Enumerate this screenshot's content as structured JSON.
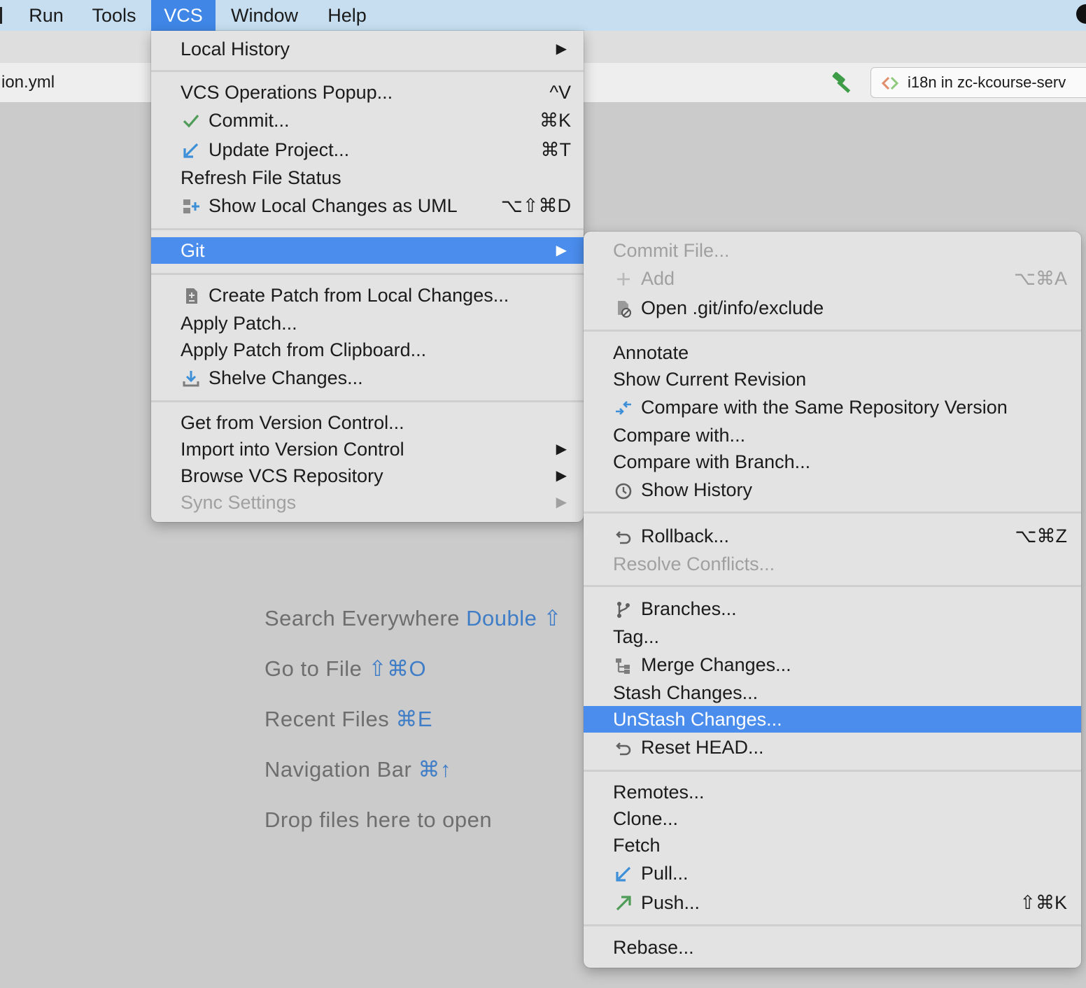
{
  "menubar": {
    "items": [
      "Run",
      "Tools",
      "VCS",
      "Window",
      "Help"
    ],
    "active": "VCS"
  },
  "editor": {
    "file_tab": "ion.yml",
    "run_config": "i18n in zc-kcourse-serv"
  },
  "hints": [
    {
      "text": "Search Everywhere",
      "key": "Double ⇧"
    },
    {
      "text": "Go to File",
      "key": "⇧⌘O"
    },
    {
      "text": "Recent Files",
      "key": "⌘E"
    },
    {
      "text": "Navigation Bar",
      "key": "⌘↑"
    },
    {
      "text": "Drop files here to open",
      "key": ""
    }
  ],
  "vcs_menu": {
    "local_history": {
      "label": "Local History"
    },
    "vcs_ops_popup": {
      "label": "VCS Operations Popup...",
      "shortcut": "^V"
    },
    "commit": {
      "label": "Commit...",
      "shortcut": "⌘K",
      "icon": "checkmark-icon"
    },
    "update_project": {
      "label": "Update Project...",
      "shortcut": "⌘T",
      "icon": "update-arrow-icon"
    },
    "refresh_status": {
      "label": "Refresh File Status"
    },
    "show_uml": {
      "label": "Show Local Changes as UML",
      "shortcut": "⌥⇧⌘D",
      "icon": "uml-icon"
    },
    "git": {
      "label": "Git"
    },
    "create_patch": {
      "label": "Create Patch from Local Changes...",
      "icon": "patch-icon"
    },
    "apply_patch": {
      "label": "Apply Patch..."
    },
    "apply_patch_clipboard": {
      "label": "Apply Patch from Clipboard..."
    },
    "shelve": {
      "label": "Shelve Changes...",
      "icon": "shelve-icon"
    },
    "get_from_vc": {
      "label": "Get from Version Control..."
    },
    "import_vc": {
      "label": "Import into Version Control"
    },
    "browse_repo": {
      "label": "Browse VCS Repository"
    },
    "sync_settings": {
      "label": "Sync Settings"
    }
  },
  "git_menu": {
    "commit_file": {
      "label": "Commit File..."
    },
    "add": {
      "label": "Add",
      "shortcut": "⌥⌘A",
      "icon": "plus-icon"
    },
    "open_exclude": {
      "label": "Open .git/info/exclude",
      "icon": "exclude-file-icon"
    },
    "annotate": {
      "label": "Annotate"
    },
    "show_current_revision": {
      "label": "Show Current Revision"
    },
    "compare_same_repo": {
      "label": "Compare with the Same Repository Version",
      "icon": "compare-icon"
    },
    "compare_with": {
      "label": "Compare with..."
    },
    "compare_branch": {
      "label": "Compare with Branch..."
    },
    "show_history": {
      "label": "Show History",
      "icon": "clock-icon"
    },
    "rollback": {
      "label": "Rollback...",
      "shortcut": "⌥⌘Z",
      "icon": "undo-icon"
    },
    "resolve_conflicts": {
      "label": "Resolve Conflicts..."
    },
    "branches": {
      "label": "Branches...",
      "icon": "branch-icon"
    },
    "tag": {
      "label": "Tag..."
    },
    "merge_changes": {
      "label": "Merge Changes...",
      "icon": "merge-icon"
    },
    "stash_changes": {
      "label": "Stash Changes..."
    },
    "unstash_changes": {
      "label": "UnStash Changes..."
    },
    "reset_head": {
      "label": "Reset HEAD...",
      "icon": "undo-icon"
    },
    "remotes": {
      "label": "Remotes..."
    },
    "clone": {
      "label": "Clone..."
    },
    "fetch": {
      "label": "Fetch"
    },
    "pull": {
      "label": "Pull...",
      "icon": "pull-arrow-icon"
    },
    "push": {
      "label": "Push...",
      "shortcut": "⇧⌘K",
      "icon": "push-arrow-icon"
    },
    "rebase": {
      "label": "Rebase..."
    }
  },
  "colors": {
    "menu_bg": "#e3e3e3",
    "selection": "#4a8ded",
    "menubar_active": "#3f86e6",
    "disabled_text": "#a0a0a0",
    "hint_key": "#3f7dc7"
  }
}
